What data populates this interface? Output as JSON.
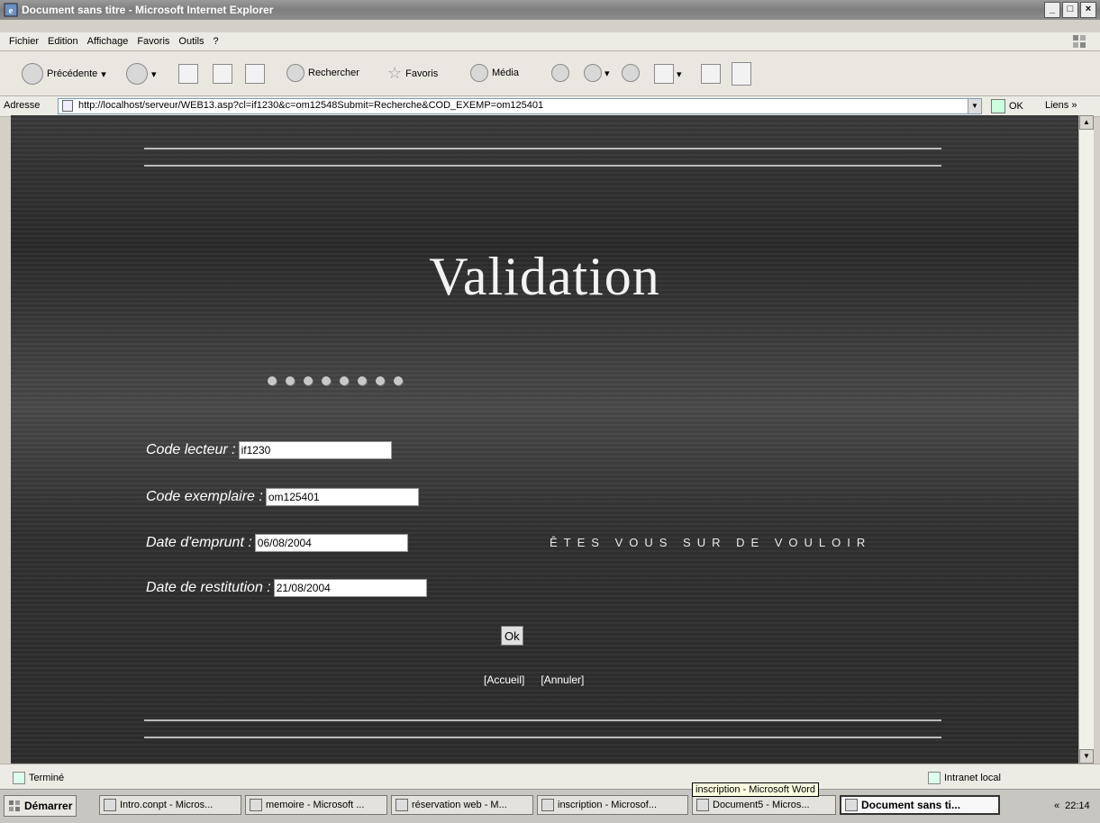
{
  "window": {
    "title": "Document sans titre - Microsoft Internet Explorer",
    "buttons": [
      "_",
      "□",
      "×"
    ]
  },
  "menubar": {
    "items": [
      "Fichier",
      "Edition",
      "Affichage",
      "Favoris",
      "Outils",
      "?"
    ]
  },
  "toolbar": {
    "back_label": "Précédente",
    "search_label": "Rechercher",
    "favorites_label": "Favoris",
    "media_label": "Média"
  },
  "address": {
    "label": "Adresse",
    "url": "http://localhost/serveur/WEB13.asp?cl=if1230&c=om12548Submit=Recherche&COD_EXEMP=om125401",
    "go_label": "OK",
    "links_label": "Liens »"
  },
  "page": {
    "title": "Validation",
    "fields": [
      {
        "label": "Code lecteur :",
        "value": "if1230"
      },
      {
        "label": "Code exemplaire :",
        "value": "om125401"
      },
      {
        "label": "Date d'emprunt :",
        "value": "06/08/2004"
      },
      {
        "label": "Date de restitution :",
        "value": "21/08/2004"
      }
    ],
    "confirm_text": "ÊTES VOUS SUR DE VOULOIR",
    "ok_label": "Ok",
    "links": [
      "[Accueil]",
      "[Annuler]"
    ]
  },
  "statusbar": {
    "left": "Terminé",
    "right": "Intranet local"
  },
  "taskbar": {
    "start_label": "Démarrer",
    "tasks": [
      "Intro.conpt - Micros...",
      "memoire - Microsoft ...",
      "réservation web - M...",
      "inscription - Microsof...",
      "Document5 - Micros...",
      "Document sans ti..."
    ],
    "tooltip": "inscription - Microsoft Word",
    "clock": "22:14",
    "tray_chevron": "«"
  }
}
